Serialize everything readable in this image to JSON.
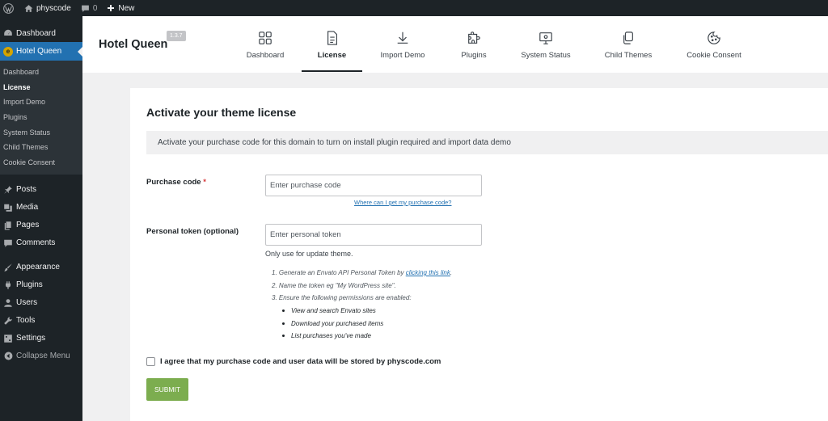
{
  "adminbar": {
    "site_name": "physcode",
    "comments_count": "0",
    "new_label": "New"
  },
  "sidebar": {
    "top_items": [
      {
        "label": "Dashboard",
        "icon": "dashboard-icon"
      },
      {
        "label": "Hotel Queen",
        "icon": "theme-icon"
      }
    ],
    "submenu": [
      "Dashboard",
      "License",
      "Import Demo",
      "Plugins",
      "System Status",
      "Child Themes",
      "Cookie Consent"
    ],
    "active_submenu": "License",
    "items": [
      {
        "label": "Posts",
        "icon": "pin-icon"
      },
      {
        "label": "Media",
        "icon": "media-icon"
      },
      {
        "label": "Pages",
        "icon": "pages-icon"
      },
      {
        "label": "Comments",
        "icon": "comment-icon"
      },
      {
        "label": "Appearance",
        "icon": "brush-icon"
      },
      {
        "label": "Plugins",
        "icon": "plugin-icon"
      },
      {
        "label": "Users",
        "icon": "users-icon"
      },
      {
        "label": "Tools",
        "icon": "wrench-icon"
      },
      {
        "label": "Settings",
        "icon": "settings-icon"
      }
    ],
    "collapse_label": "Collapse Menu"
  },
  "header": {
    "brand": "Hotel Queen",
    "version": "1.3.7",
    "tabs": [
      {
        "label": "Dashboard",
        "icon": "grid-icon"
      },
      {
        "label": "License",
        "icon": "document-icon"
      },
      {
        "label": "Import Demo",
        "icon": "download-icon"
      },
      {
        "label": "Plugins",
        "icon": "puzzle-icon"
      },
      {
        "label": "System Status",
        "icon": "monitor-icon"
      },
      {
        "label": "Child Themes",
        "icon": "copy-icon"
      },
      {
        "label": "Cookie Consent",
        "icon": "cookie-icon"
      }
    ],
    "active_tab": "License"
  },
  "main": {
    "title": "Activate your theme license",
    "notice": "Activate your purchase code for this domain to turn on install plugin required and import data demo",
    "purchase_label": "Purchase code",
    "required_mark": "*",
    "purchase_placeholder": "Enter purchase code",
    "purchase_value": "",
    "help_link": "Where can I get my purchase code?",
    "token_label": "Personal token (optional)",
    "token_placeholder": "Enter personal token",
    "token_value": "",
    "only_use": "Only use for update theme.",
    "step1_prefix": "1. Generate an Envato API Personal Token by ",
    "step1_link": "clicking this link",
    "step1_suffix": ".",
    "step2": "2. Name the token eg \"My WordPress site\".",
    "step3": "3. Ensure the following permissions are enabled:",
    "permissions": [
      "View and search Envato sites",
      "Download your purchased items",
      "List purchases you've made"
    ],
    "agree_label": "I agree that my purchase code and user data will be stored by physcode.com",
    "agree_checked": false,
    "submit_label": "SUBMIT"
  },
  "colors": {
    "adminbar": "#1d2327",
    "accent": "#2271b1",
    "submit": "#7cad4f",
    "background": "#f0f0f1"
  }
}
